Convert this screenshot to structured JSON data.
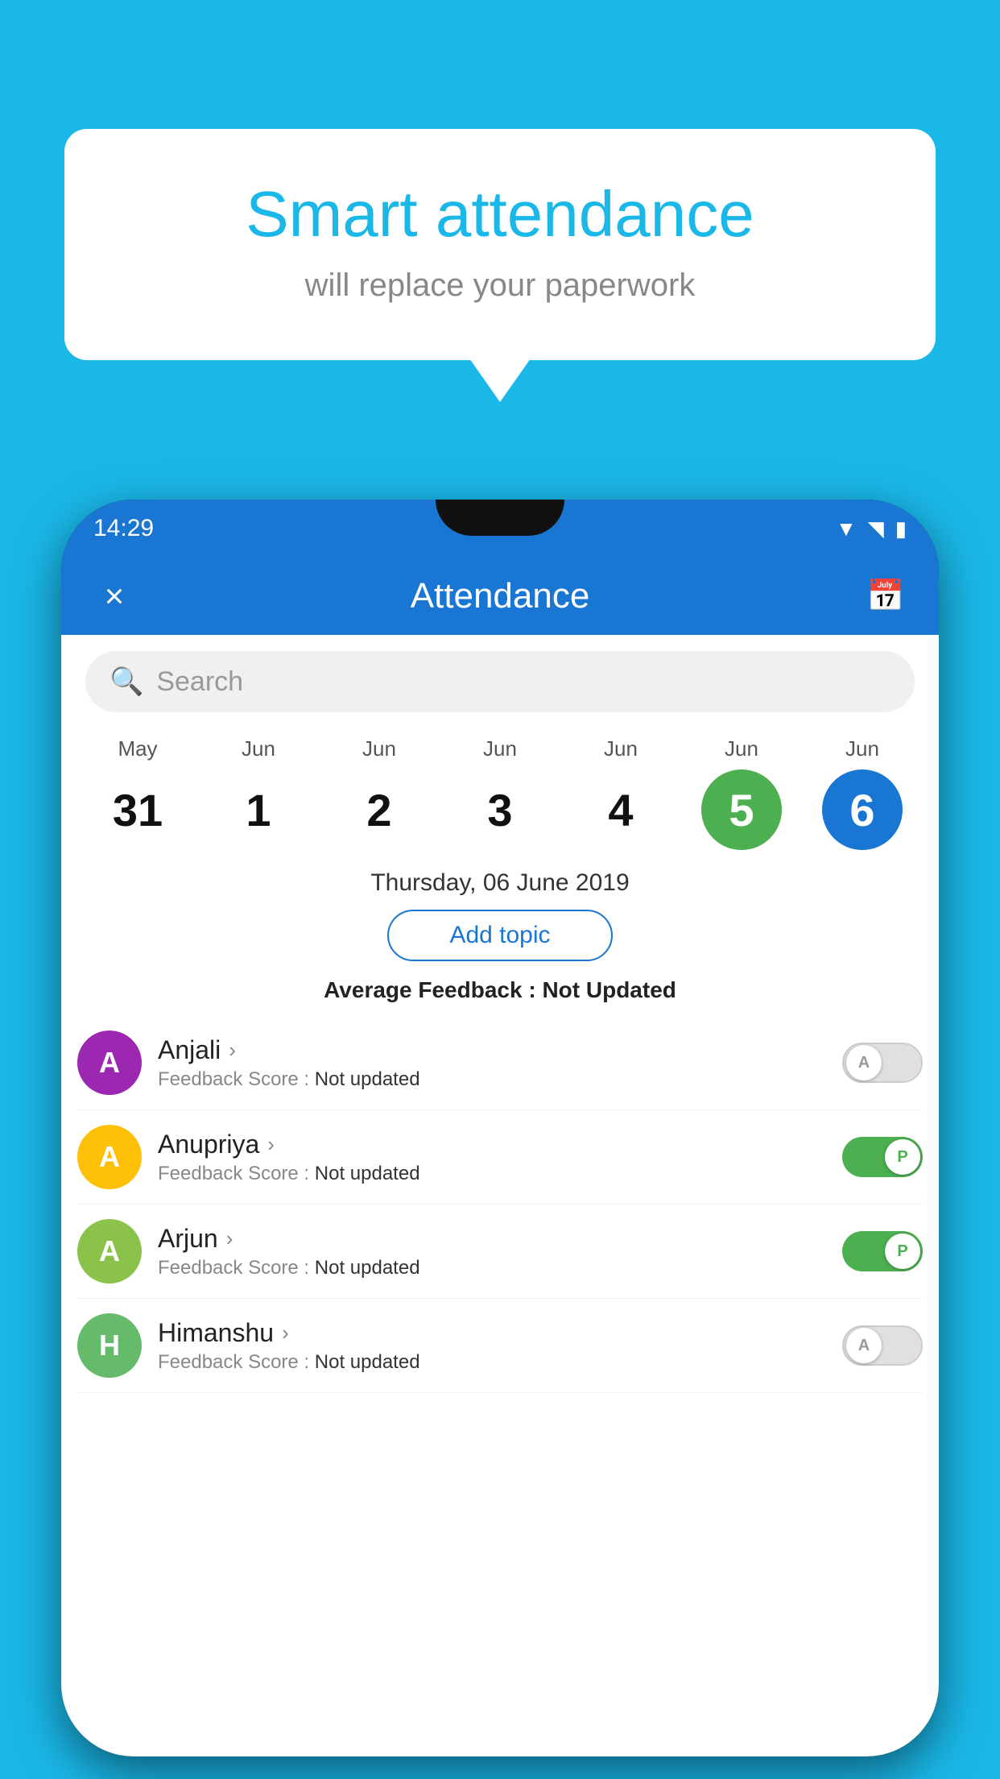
{
  "background_color": "#1ab8e8",
  "bubble": {
    "title": "Smart attendance",
    "subtitle": "will replace your paperwork"
  },
  "status_bar": {
    "time": "14:29",
    "icons": [
      "wifi",
      "signal",
      "battery"
    ]
  },
  "app_bar": {
    "title": "Attendance",
    "close_label": "×",
    "calendar_icon": "📅"
  },
  "search": {
    "placeholder": "Search"
  },
  "calendar": {
    "days": [
      {
        "month": "May",
        "date": "31",
        "style": "normal"
      },
      {
        "month": "Jun",
        "date": "1",
        "style": "normal"
      },
      {
        "month": "Jun",
        "date": "2",
        "style": "normal"
      },
      {
        "month": "Jun",
        "date": "3",
        "style": "normal"
      },
      {
        "month": "Jun",
        "date": "4",
        "style": "normal"
      },
      {
        "month": "Jun",
        "date": "5",
        "style": "green"
      },
      {
        "month": "Jun",
        "date": "6",
        "style": "blue"
      }
    ]
  },
  "selected_date": "Thursday, 06 June 2019",
  "add_topic_label": "Add topic",
  "avg_feedback_label": "Average Feedback :",
  "avg_feedback_value": "Not Updated",
  "students": [
    {
      "name": "Anjali",
      "initial": "A",
      "avatar_color": "purple",
      "feedback": "Not updated",
      "toggle": "off",
      "toggle_label": "A"
    },
    {
      "name": "Anupriya",
      "initial": "A",
      "avatar_color": "yellow",
      "feedback": "Not updated",
      "toggle": "on",
      "toggle_label": "P"
    },
    {
      "name": "Arjun",
      "initial": "A",
      "avatar_color": "green-light",
      "feedback": "Not updated",
      "toggle": "on",
      "toggle_label": "P"
    },
    {
      "name": "Himanshu",
      "initial": "H",
      "avatar_color": "green-dark",
      "feedback": "Not updated",
      "toggle": "off",
      "toggle_label": "A"
    }
  ]
}
